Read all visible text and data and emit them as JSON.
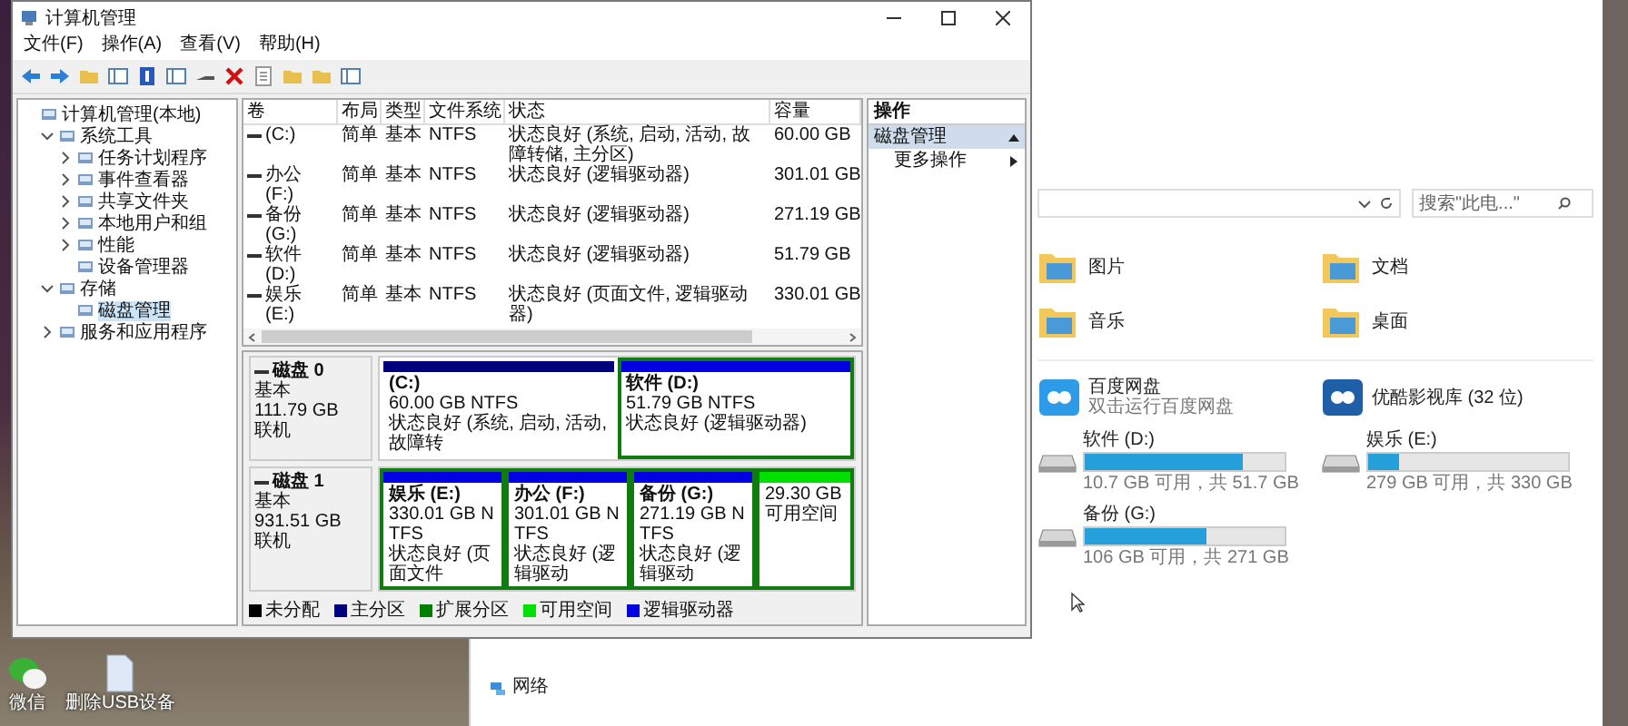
{
  "cm_window": {
    "title": "计算机管理",
    "menu": [
      "文件(F)",
      "操作(A)",
      "查看(V)",
      "帮助(H)"
    ],
    "tree": [
      {
        "label": "计算机管理(本地)",
        "selected": false,
        "children": [
          {
            "label": "系统工具",
            "expanded": true,
            "selected": false,
            "children": [
              {
                "label": "任务计划程序",
                "expanded": false,
                "selected": false
              },
              {
                "label": "事件查看器",
                "expanded": false,
                "selected": false
              },
              {
                "label": "共享文件夹",
                "expanded": false,
                "selected": false
              },
              {
                "label": "本地用户和组",
                "expanded": false,
                "selected": false
              },
              {
                "label": "性能",
                "expanded": false,
                "selected": false
              },
              {
                "label": "设备管理器",
                "selected": false
              }
            ]
          },
          {
            "label": "存储",
            "expanded": true,
            "selected": false,
            "children": [
              {
                "label": "磁盘管理",
                "selected": true
              }
            ]
          },
          {
            "label": "服务和应用程序",
            "expanded": false,
            "selected": false
          }
        ]
      }
    ],
    "volume_table": {
      "columns": [
        "卷",
        "布局",
        "类型",
        "文件系统",
        "状态",
        "容量"
      ],
      "rows": [
        [
          "(C:)",
          "简单",
          "基本",
          "NTFS",
          "状态良好 (系统, 启动, 活动, 故障转储, 主分区)",
          "60.00 GB"
        ],
        [
          "办公 (F:)",
          "简单",
          "基本",
          "NTFS",
          "状态良好 (逻辑驱动器)",
          "301.01 GB"
        ],
        [
          "备份 (G:)",
          "简单",
          "基本",
          "NTFS",
          "状态良好 (逻辑驱动器)",
          "271.19 GB"
        ],
        [
          "软件 (D:)",
          "简单",
          "基本",
          "NTFS",
          "状态良好 (逻辑驱动器)",
          "51.79 GB"
        ],
        [
          "娱乐 (E:)",
          "简单",
          "基本",
          "NTFS",
          "状态良好 (页面文件, 逻辑驱动器)",
          "330.01 GB"
        ]
      ]
    },
    "disks": [
      {
        "name": "磁盘 0",
        "type": "基本",
        "size": "111.79 GB",
        "status": "联机",
        "partitions": [
          {
            "name": "(C:)",
            "size": "60.00 GB NTFS",
            "status": "状态良好 (系统, 启动, 活动, 故障转",
            "color": "#00007f",
            "in_extended": false
          },
          {
            "name": "软件 (D:)",
            "size": "51.79 GB NTFS",
            "status": "状态良好 (逻辑驱动器)",
            "color": "#0000e0",
            "in_extended": true
          }
        ]
      },
      {
        "name": "磁盘 1",
        "type": "基本",
        "size": "931.51 GB",
        "status": "联机",
        "partitions": [
          {
            "name": "娱乐 (E:)",
            "size": "330.01 GB NTFS",
            "status": "状态良好 (页面文件",
            "color": "#0000e0",
            "in_extended": true
          },
          {
            "name": "办公 (F:)",
            "size": "301.01 GB NTFS",
            "status": "状态良好 (逻辑驱动",
            "color": "#0000e0",
            "in_extended": true
          },
          {
            "name": "备份 (G:)",
            "size": "271.19 GB NTFS",
            "status": "状态良好 (逻辑驱动",
            "color": "#0000e0",
            "in_extended": true
          },
          {
            "size": "29.30 GB",
            "status": "可用空间",
            "color": "#00e000",
            "in_extended": true
          }
        ]
      }
    ],
    "legend": [
      {
        "label": "未分配",
        "color": "#000000"
      },
      {
        "label": "主分区",
        "color": "#00007f"
      },
      {
        "label": "扩展分区",
        "color": "#008000"
      },
      {
        "label": "可用空间",
        "color": "#00e000"
      },
      {
        "label": "逻辑驱动器",
        "color": "#0000e0"
      }
    ],
    "actions": {
      "header": "操作",
      "section": "磁盘管理",
      "items": [
        "更多操作"
      ]
    }
  },
  "explorer": {
    "search": {
      "placeholder": "搜索\"此电...\""
    },
    "folders": [
      "图片",
      "文档",
      "音乐",
      "桌面"
    ],
    "apps": [
      {
        "name": "百度网盘",
        "subtitle": "双击运行百度网盘"
      },
      {
        "name": "优酷影视库 (32 位)"
      }
    ],
    "drives": [
      {
        "name": "软件 (D:)",
        "level": 0.79,
        "free": "10.7 GB 可用，共 51.7 GB"
      },
      {
        "name": "娱乐 (E:)",
        "level": 0.15,
        "free": "279 GB 可用，共 330 GB"
      },
      {
        "name": "备份 (G:)",
        "level": 0.61,
        "free": "106 GB 可用，共 271 GB"
      }
    ],
    "nav": [
      "网络"
    ]
  },
  "desktop_icons": [
    {
      "label": "微信"
    },
    {
      "label": "删除USB设备"
    }
  ]
}
